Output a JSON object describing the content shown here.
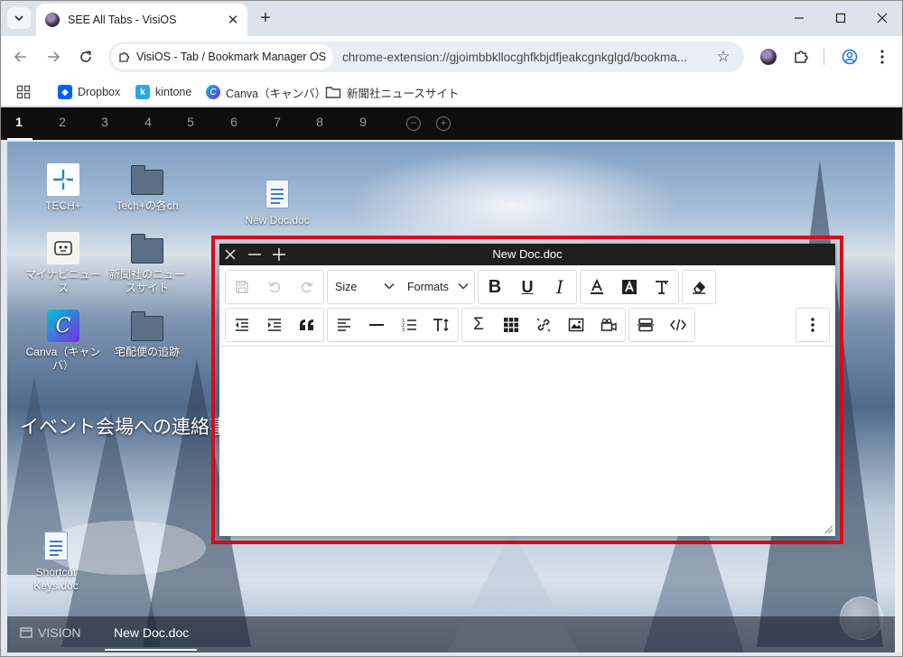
{
  "browser": {
    "tab_title": "SEE All Tabs - VisiOS",
    "site_chip": "VisiOS - Tab / Bookmark Manager OS",
    "url": "chrome-extension://gjoimbbkllocghfkbjdfjeakcgnkglgd/bookma...",
    "bookmarks": [
      "Dropbox",
      "kintone",
      "Canva（キャンバ）",
      "新聞社ニュースサイト"
    ]
  },
  "visios": {
    "workspaces": [
      "1",
      "2",
      "3",
      "4",
      "5",
      "6",
      "7",
      "8",
      "9"
    ],
    "active_workspace": "1",
    "desktop_icons": [
      {
        "label": "TECH+"
      },
      {
        "label": "Tech+の各ch"
      },
      {
        "label": "New Doc.doc"
      },
      {
        "label": "マイナビニュース"
      },
      {
        "label": "新聞社のニュースサイト"
      },
      {
        "label": "Canva（キャンバ）"
      },
      {
        "label": "宅配便の追跡"
      },
      {
        "label": "Shortcut Keys.doc"
      }
    ],
    "desktop_text": "イベント会場への連絡事",
    "taskbar": {
      "vision": "VISION",
      "active_task": "New Doc.doc"
    }
  },
  "editor": {
    "title": "New Doc.doc",
    "size_select": "Size",
    "formats_select": "Formats"
  },
  "colors": {
    "highlight": "#e00a18",
    "titlebar": "#1f1f1f"
  }
}
